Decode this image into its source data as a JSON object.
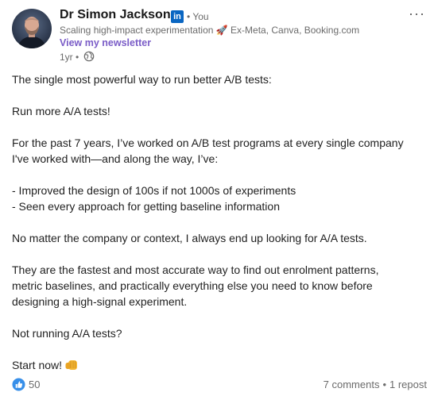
{
  "header": {
    "author_name": "Dr Simon Jackson",
    "linkedin_badge": "in",
    "you_label": "• You",
    "headline": "Scaling high-impact experimentation 🚀 Ex-Meta, Canva, Booking.com",
    "newsletter_link": "View my newsletter",
    "time": "1yr •",
    "visibility_icon": "globe-icon",
    "more_menu": "···"
  },
  "body": {
    "p1": "The single most powerful way to run better A/B tests:",
    "p2": "Run more A/A tests!",
    "p3_line1": "For the past 7 years, I’ve worked on A/B test programs at every single company",
    "p3_line2": "I've worked with—and along the way, I’ve:",
    "bullet1": "- Improved the design of 100s if not 1000s of experiments",
    "bullet2": "- Seen every approach for getting baseline information",
    "p4": "No matter the company or context, I always end up looking for A/A tests.",
    "p5_line1": "They are the fastest and most accurate way to find out enrolment patterns,",
    "p5_line2": "metric baselines, and practically everything else you need to know before",
    "p5_line3": "designing a high-signal experiment.",
    "p6": "Not running A/A tests?",
    "p7": "Start now!",
    "p7_emoji": "fist-bump-icon"
  },
  "footer": {
    "reaction_icon": "like-icon",
    "reaction_count": "50",
    "comments": "7 comments",
    "separator": "•",
    "reposts": "1 repost"
  },
  "colors": {
    "newsletter": "#7a5cc7",
    "linkedin_blue": "#0a66c2",
    "muted_text": "#6b6b6b"
  }
}
